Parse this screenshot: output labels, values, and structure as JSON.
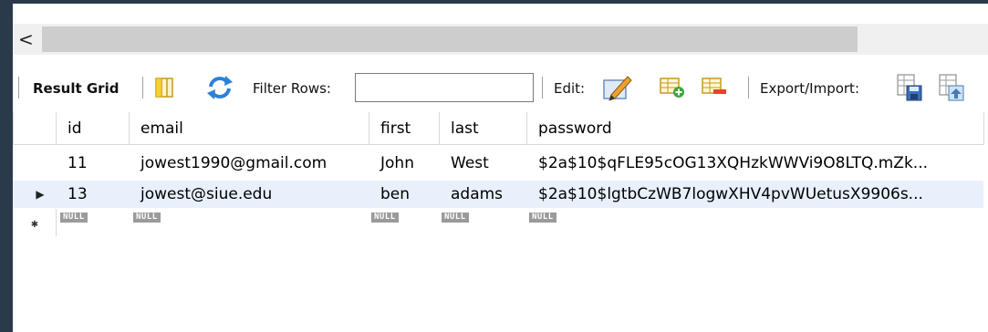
{
  "scrollbar": {
    "left_arrow": "<"
  },
  "toolbar": {
    "result_grid": "Result Grid",
    "filter_rows_label": "Filter Rows:",
    "filter_value": "",
    "edit_label": "Edit:",
    "export_import_label": "Export/Import:"
  },
  "grid": {
    "columns": [
      "id",
      "email",
      "first",
      "last",
      "password"
    ],
    "rows": [
      {
        "marker": "",
        "cells": [
          "11",
          "jowest1990@gmail.com",
          "John",
          "West",
          "$2a$10$qFLE95cOG13XQHzkWWVi9O8LTQ.mZk..."
        ]
      },
      {
        "marker": "▶",
        "cells": [
          "13",
          "jowest@siue.edu",
          "ben",
          "adams",
          "$2a$10$lgtbCzWB7logwXHV4pvWUetusX9906s..."
        ]
      }
    ],
    "new_row": {
      "marker": "✱",
      "cells": [
        "NULL",
        "NULL",
        "NULL",
        "NULL",
        "NULL"
      ]
    }
  },
  "colors": {
    "selected_row": "#e8f0fb",
    "frame_bg": "#2b3a4a"
  }
}
